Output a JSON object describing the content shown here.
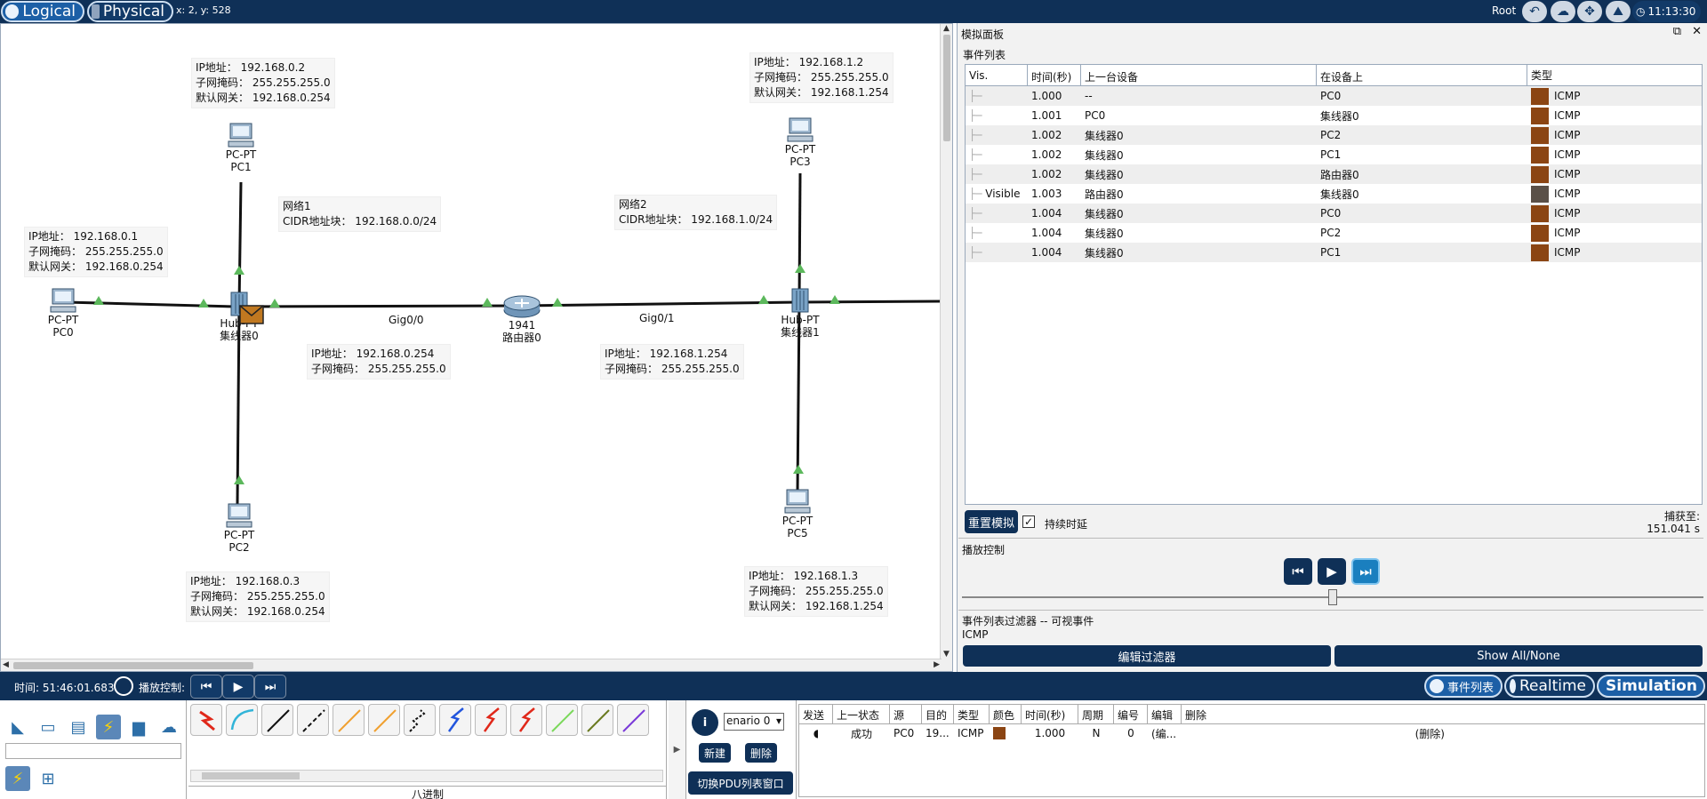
{
  "topbar": {
    "logical_label": "Logical",
    "physical_label": "Physical",
    "coords": "x: 2, y: 528",
    "root_label": "Root",
    "clock": "11:13:30"
  },
  "topology": {
    "pc0": {
      "model": "PC-PT",
      "name": "PC0"
    },
    "pc1": {
      "model": "PC-PT",
      "name": "PC1"
    },
    "pc2": {
      "model": "PC-PT",
      "name": "PC2"
    },
    "pc3": {
      "model": "PC-PT",
      "name": "PC3"
    },
    "pc5": {
      "model": "PC-PT",
      "name": "PC5"
    },
    "hub0": {
      "model": "Hub-PT",
      "name": "集线器0"
    },
    "hub1": {
      "model": "Hub-PT",
      "name": "集线器1"
    },
    "router": {
      "model": "1941",
      "name": "路由器0"
    },
    "port_g00": "Gig0/0",
    "port_g01": "Gig0/1",
    "info_pc1": {
      "ip": "IP地址： 192.168.0.2",
      "mask": "子网掩码： 255.255.255.0",
      "gw": "默认网关： 192.168.0.254"
    },
    "info_pc0": {
      "ip": "IP地址： 192.168.0.1",
      "mask": "子网掩码： 255.255.255.0",
      "gw": "默认网关： 192.168.0.254"
    },
    "info_pc2": {
      "ip": "IP地址： 192.168.0.3",
      "mask": "子网掩码： 255.255.255.0",
      "gw": "默认网关： 192.168.0.254"
    },
    "info_pc3": {
      "ip": "IP地址： 192.168.1.2",
      "mask": "子网掩码： 255.255.255.0",
      "gw": "默认网关： 192.168.1.254"
    },
    "info_pc5": {
      "ip": "IP地址： 192.168.1.3",
      "mask": "子网掩码： 255.255.255.0",
      "gw": "默认网关： 192.168.1.254"
    },
    "info_g00": {
      "ip": "IP地址： 192.168.0.254",
      "mask": "子网掩码： 255.255.255.0"
    },
    "info_g01": {
      "ip": "IP地址： 192.168.1.254",
      "mask": "子网掩码： 255.255.255.0"
    },
    "net1": {
      "name": "网络1",
      "cidr": "CIDR地址块： 192.168.0.0/24"
    },
    "net2": {
      "name": "网络2",
      "cidr": "CIDR地址块： 192.168.1.0/24"
    }
  },
  "sim_panel": {
    "title": "模拟面板",
    "event_list_label": "事件列表",
    "columns": [
      "Vis.",
      "时间(秒)",
      "上一台设备",
      "在设备上",
      "类型"
    ],
    "events": [
      {
        "vis": "",
        "time": "1.000",
        "prev": "--",
        "on": "PC0",
        "type": "ICMP",
        "color": "#8b4513"
      },
      {
        "vis": "",
        "time": "1.001",
        "prev": "PC0",
        "on": "集线器0",
        "type": "ICMP",
        "color": "#8b4513"
      },
      {
        "vis": "",
        "time": "1.002",
        "prev": "集线器0",
        "on": "PC2",
        "type": "ICMP",
        "color": "#8b4513"
      },
      {
        "vis": "",
        "time": "1.002",
        "prev": "集线器0",
        "on": "PC1",
        "type": "ICMP",
        "color": "#8b4513"
      },
      {
        "vis": "",
        "time": "1.002",
        "prev": "集线器0",
        "on": "路由器0",
        "type": "ICMP",
        "color": "#8b4513"
      },
      {
        "vis": "Visible",
        "time": "1.003",
        "prev": "路由器0",
        "on": "集线器0",
        "type": "ICMP",
        "color": "#5a5048"
      },
      {
        "vis": "",
        "time": "1.004",
        "prev": "集线器0",
        "on": "PC0",
        "type": "ICMP",
        "color": "#8b4513"
      },
      {
        "vis": "",
        "time": "1.004",
        "prev": "集线器0",
        "on": "PC2",
        "type": "ICMP",
        "color": "#8b4513"
      },
      {
        "vis": "",
        "time": "1.004",
        "prev": "集线器0",
        "on": "PC1",
        "type": "ICMP",
        "color": "#8b4513"
      }
    ],
    "reset_label": "重置模拟",
    "constant_delay_label": "持续时延",
    "constant_delay_checked": true,
    "captured_label": "捕获至:",
    "captured_value": "151.041 s",
    "playback_label": "播放控制",
    "filter_label": "事件列表过滤器 -- 可视事件",
    "filter_value": "ICMP",
    "edit_filter_label": "编辑过滤器",
    "show_all_label": "Show All/None"
  },
  "statusbar": {
    "time_text": "时间: 51:46:01.683",
    "playback_text": "播放控制:",
    "event_list_btn": "事件列表",
    "realtime_btn": "Realtime",
    "simulation_btn": "Simulation"
  },
  "bottom": {
    "cable_caption": "八进制",
    "scenario": "enario 0",
    "new_label": "新建",
    "delete_label": "删除",
    "toggle_pdu_label": "切换PDU列表窗口",
    "pdu_columns": [
      "发送",
      "上一状态",
      "源",
      "目的",
      "类型",
      "颜色",
      "时间(秒)",
      "周期",
      "编号",
      "编辑",
      "删除"
    ],
    "pdu_row": {
      "state": "成功",
      "src": "PC0",
      "dst": "19...",
      "type": "ICMP",
      "time": "1.000",
      "periodic": "N",
      "num": "0",
      "edit": "(编...",
      "delete": "(删除)"
    }
  }
}
